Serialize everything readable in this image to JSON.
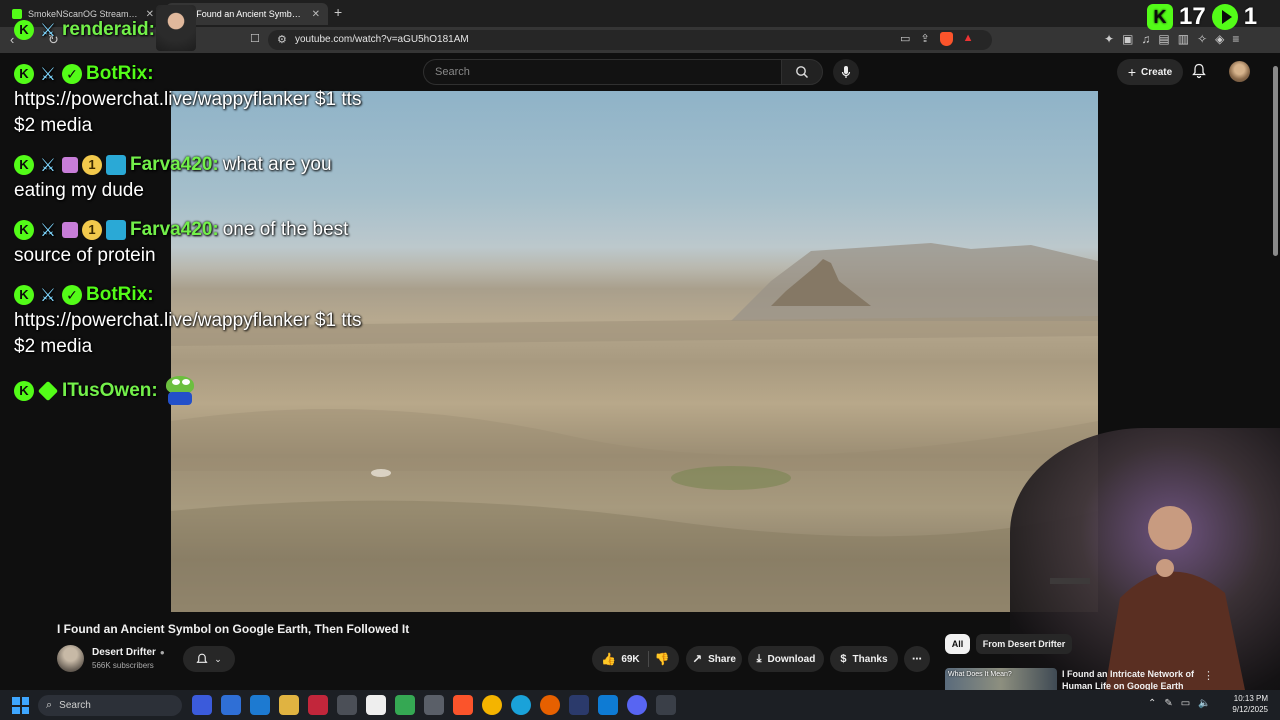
{
  "browser": {
    "tabs": [
      {
        "title": "SmokeNScanOG Stream - Watch Live",
        "active": false
      },
      {
        "title": "I Found an Ancient Symbol on Google Earth",
        "active": true
      }
    ],
    "url": "youtube.com/watch?v=aGU5hO181AM"
  },
  "youtube": {
    "search_placeholder": "Search",
    "create_label": "Create",
    "video_title": "I Found an Ancient Symbol on Google Earth, Then Followed It",
    "channel_name": "Desert Drifter",
    "channel_subs": "566K subscribers",
    "like_count": "69K",
    "share_label": "Share",
    "download_label": "Download",
    "thanks_label": "Thanks",
    "chips": {
      "all": "All",
      "from": "From Desert Drifter"
    },
    "recommended": {
      "thumb_text": "What Does It Mean?",
      "title": "I Found an Intricate Network of Human Life on Google Earth"
    }
  },
  "chat": {
    "messages": [
      {
        "user": "renderaid:",
        "text": ""
      },
      {
        "user": "BotRix:",
        "text": "https://powerchat.live/wappyflanker $1 tts",
        "text2": "$2 media"
      },
      {
        "user": "Farva420:",
        "text": "what are you",
        "text2": "eating my dude"
      },
      {
        "user": "Farva420:",
        "text": "one of the best",
        "text2": "source of protein"
      },
      {
        "user": "BotRix:",
        "text": "https://powerchat.live/wappyflanker $1 tts",
        "text2": "$2 media"
      },
      {
        "user": "ITusOwen:",
        "text": ""
      }
    ],
    "stats": {
      "viewers": "17",
      "count2": "1"
    }
  },
  "taskbar": {
    "search_label": "Search",
    "time": "10:13 PM",
    "date": "9/12/2025"
  },
  "colors": {
    "kick_green": "#53fc18",
    "yt_bg": "#0f0f0f",
    "pill_bg": "#272727"
  }
}
